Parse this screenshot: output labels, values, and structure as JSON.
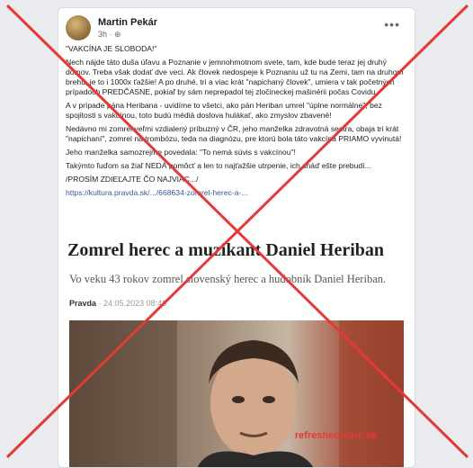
{
  "post": {
    "author": "Martin Pekár",
    "time": "3h · ⊕",
    "more_icon": "•••",
    "paragraphs": [
      "\"VAKCÍNA JE SLOBODA!\"",
      "Nech nájde táto duša úľavu a Poznanie v jemnohmotnom svete, tam, kde bude teraz jej druhý domov. Treba však dodať dve veci. Ak človek nedospeje k Poznaniu už tu na Zemi, tam na druhom brehu, je to i 1000x ťažšie! A po druhé, tri a viac krát \"napichaný človek\", umiera v tak početných prípadoch PREDČASNE, pokiaľ by sám neprepadol tej zločineckej mašinérii počas Covidu.",
      "A v prípade pána Heribana - uvidíme to všetci, ako pán Heriban umrel \"úplne normálne\", bez spojitosti s vakcínou, toto budú médiá doslova hulákať, ako zmyslov zbavené!",
      "Nedávno mi zomrel veľmi vzdialený príbuzný v ČR, jeho manželka zdravotná sestra, obaja tri krát \"napichaní\", zomrel na trombózu, teda na diagnózu, pre ktorú bola táto vakcína PRIAMO vyvinutá!",
      "Jeho manželka samozrejme povedala: \"To nemá súvis s vakcínou\"!",
      "Takýmto ľuďom sa žiaľ NEDÁ pomôcť a len to najťažšie utrpenie, ich snáď ešte prebudí...",
      "/PROSÍM ZDIEĽAJTE ČO NAJVIAC.../"
    ],
    "link": "https://kultura.pravda.sk/.../668634-zomrel-herec-a-..."
  },
  "article": {
    "title": "Zomrel herec a muzikant Daniel Heriban",
    "subtitle": "Vo veku 43 rokov zomrel slovenský herec a hudobník Daniel Heriban.",
    "source": "Pravda",
    "date": "24.05.2023 08:48",
    "watermark": "refresheonline.sk"
  }
}
